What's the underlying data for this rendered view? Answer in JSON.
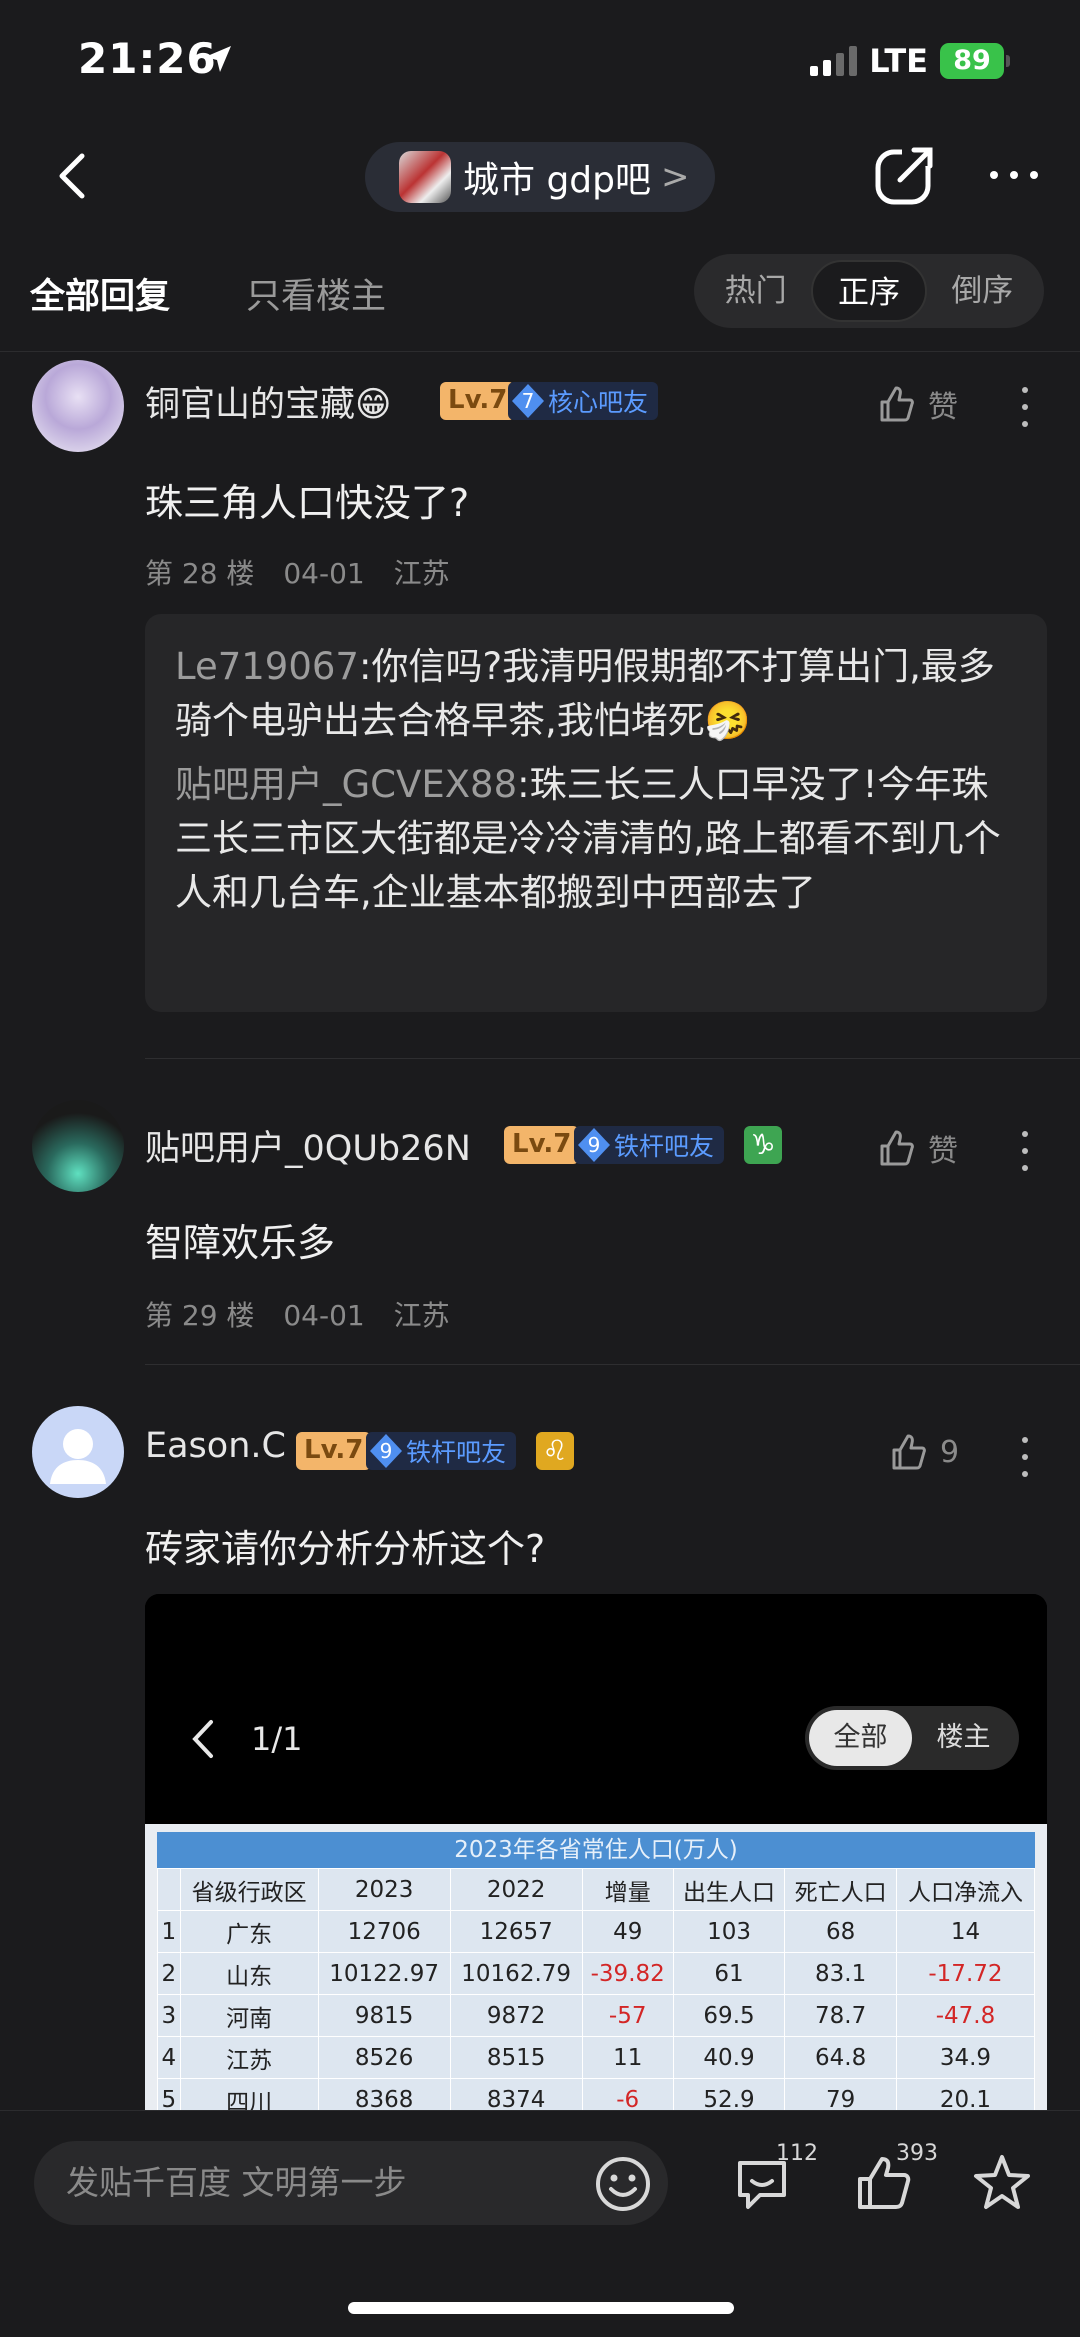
{
  "status": {
    "time": "21:26",
    "network": "LTE",
    "battery": "89"
  },
  "nav": {
    "forum_name": "城市 gdp吧",
    "forum_chevron": ">"
  },
  "tabs": {
    "all": "全部回复",
    "op_only": "只看楼主",
    "sort": [
      "热门",
      "正序",
      "倒序"
    ],
    "active_sort": "正序"
  },
  "posts": [
    {
      "username": "铜官山的宝藏😁",
      "level": "Lv.7",
      "badge_num": "7",
      "badge_text": "核心吧友",
      "like_label": "赞",
      "content": "珠三角人口快没了?",
      "floor": "第 28 楼",
      "date": "04-01",
      "location": "江苏",
      "quotes": [
        {
          "user": "Le719067",
          "text": ":你信吗?我清明假期都不打算出门,最多骑个电驴出去合格早茶,我怕堵死🤧"
        },
        {
          "user": "贴吧用户_GCVEX88",
          "text": ":珠三长三人口早没了!今年珠三长三市区大街都是冷冷清清的,路上都看不到几个人和几台车,企业基本都搬到中西部去了"
        }
      ]
    },
    {
      "username": "贴吧用户_0QUb26N",
      "level": "Lv.7",
      "badge_num": "9",
      "badge_text": "铁杆吧友",
      "zodiac": "♑",
      "like_label": "赞",
      "content": "智障欢乐多",
      "floor": "第 29 楼",
      "date": "04-01",
      "location": "江苏"
    },
    {
      "username": "Eason.C",
      "level": "Lv.7",
      "badge_num": "9",
      "badge_text": "铁杆吧友",
      "zodiac": "♌",
      "like_label": "9",
      "content": "砖家请你分析分析这个?",
      "image": {
        "page": "1/1",
        "filter": [
          "全部",
          "楼主"
        ],
        "table_title": "2023年各省常住人口(万人)",
        "headers": [
          "",
          "省级行政区",
          "2023",
          "2022",
          "增量",
          "出生人口",
          "死亡人口",
          "人口净流入"
        ],
        "rows": [
          [
            "1",
            "广东",
            "12706",
            "12657",
            "49",
            "103",
            "68",
            "14"
          ],
          [
            "2",
            "山东",
            "10122.97",
            "10162.79",
            "-39.82",
            "61",
            "83.1",
            "-17.72"
          ],
          [
            "3",
            "河南",
            "9815",
            "9872",
            "-57",
            "69.5",
            "78.7",
            "-47.8"
          ],
          [
            "4",
            "江苏",
            "8526",
            "8515",
            "11",
            "40.9",
            "64.8",
            "34.9"
          ],
          [
            "5",
            "四川",
            "8368",
            "8374",
            "-6",
            "52.9",
            "79",
            "20.1"
          ]
        ]
      }
    }
  ],
  "bottom": {
    "placeholder": "发贴千百度 文明第一步",
    "comments": "112",
    "likes": "393"
  },
  "colors": {
    "background": "#1b1b1d",
    "level_badge": "#f3b56a",
    "fan_badge": "#5b9bff",
    "negative": "#d32626",
    "battery": "#39c24a"
  }
}
